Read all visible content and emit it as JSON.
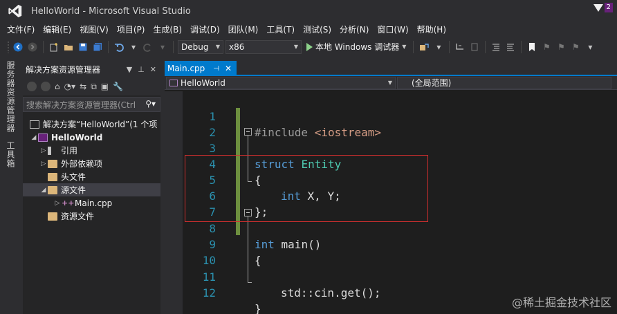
{
  "window": {
    "title": "HelloWorld - Microsoft Visual Studio",
    "notification_count": "2"
  },
  "menu": [
    "文件(F)",
    "编辑(E)",
    "视图(V)",
    "项目(P)",
    "生成(B)",
    "调试(D)",
    "团队(M)",
    "工具(T)",
    "测试(S)",
    "分析(N)",
    "窗口(W)",
    "帮助(H)"
  ],
  "toolbar": {
    "config": "Debug",
    "platform": "x86",
    "run_label": "本地 Windows 调试器"
  },
  "side_tabs": {
    "server_explorer": "服务器资源管理器",
    "toolbox": "工具箱"
  },
  "solution_explorer": {
    "title": "解决方案资源管理器",
    "search_placeholder": "搜索解决方案资源管理器(Ctrl",
    "items": [
      {
        "label": "解决方案“HelloWorld”(1 个项"
      },
      {
        "label": "HelloWorld"
      },
      {
        "label": "引用"
      },
      {
        "label": "外部依赖项"
      },
      {
        "label": "头文件"
      },
      {
        "label": "源文件"
      },
      {
        "label": "Main.cpp"
      },
      {
        "label": "资源文件"
      }
    ]
  },
  "editor": {
    "tab_label": "Main.cpp",
    "nav_project": "HelloWorld",
    "nav_scope": "(全局范围)",
    "line_numbers": [
      "1",
      "2",
      "3",
      "4",
      "5",
      "6",
      "7",
      "8",
      "9",
      "10",
      "11",
      "12"
    ],
    "lines": {
      "l1_pre": "#include ",
      "l1_inc": "<iostream>",
      "l3_kw": "struct",
      "l3_ty": "Entity",
      "l4": "{",
      "l5_kw": "int",
      "l5_rest": " X, Y;",
      "l6": "};",
      "l8_kw": "int",
      "l8_rest": " main()",
      "l9": "{",
      "l11": "std::cin.get();",
      "l12": "}"
    }
  },
  "watermark": "@稀土掘金技术社区"
}
